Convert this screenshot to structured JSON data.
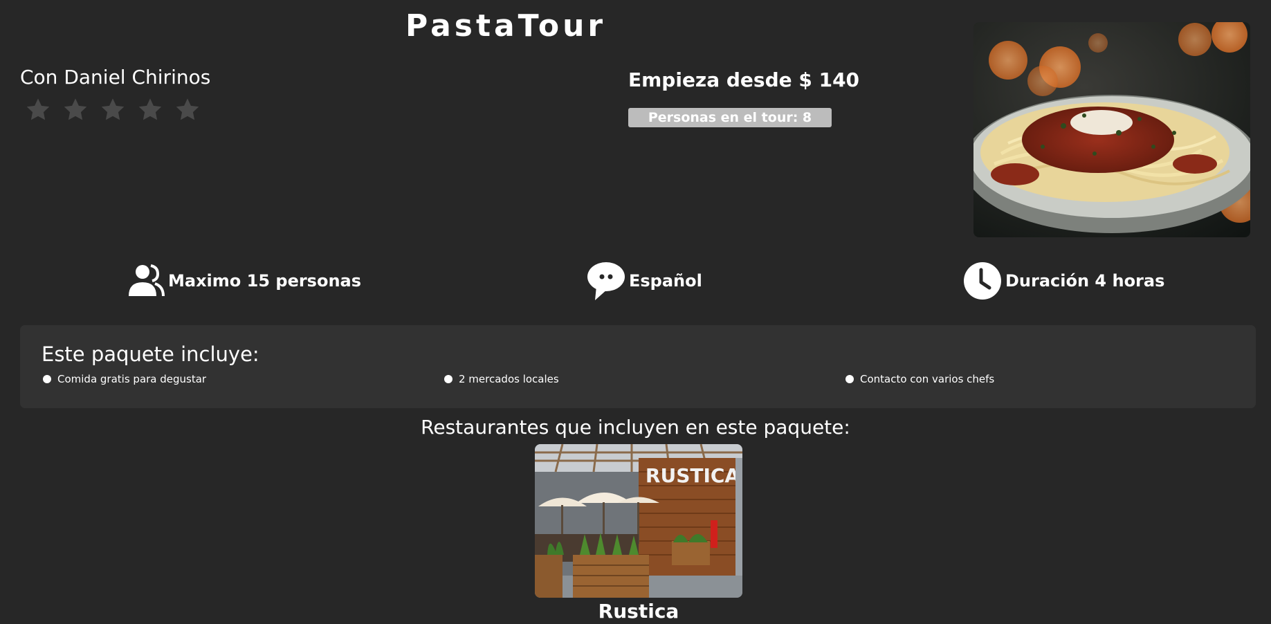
{
  "header": {
    "title": "PastaTour"
  },
  "guide": {
    "label": "Con Daniel Chirinos",
    "rating": {
      "filled": 0,
      "max": 5
    }
  },
  "pricing": {
    "price_label": "Empieza desde $ 140",
    "people_badge": "Personas en el tour: 8"
  },
  "features": [
    {
      "icon": "users-icon",
      "label": "Maximo 15 personas"
    },
    {
      "icon": "speech-bubble-icon",
      "label": "Español"
    },
    {
      "icon": "clock-icon",
      "label": "Duración 4 horas"
    }
  ],
  "includes": {
    "title": "Este paquete incluye:",
    "items": [
      "Comida gratis para degustar",
      "2 mercados locales",
      "Contacto con varios chefs"
    ]
  },
  "restaurants": {
    "title": "Restaurantes que incluyen en este paquete:",
    "items": [
      {
        "name": "Rustica",
        "sign_text": "RUSTICA"
      }
    ]
  },
  "colors": {
    "background": "#272727",
    "panel": "#323232",
    "badge": "#bcbcbc",
    "star_inactive": "#4a4a4a",
    "text": "#ffffff"
  }
}
